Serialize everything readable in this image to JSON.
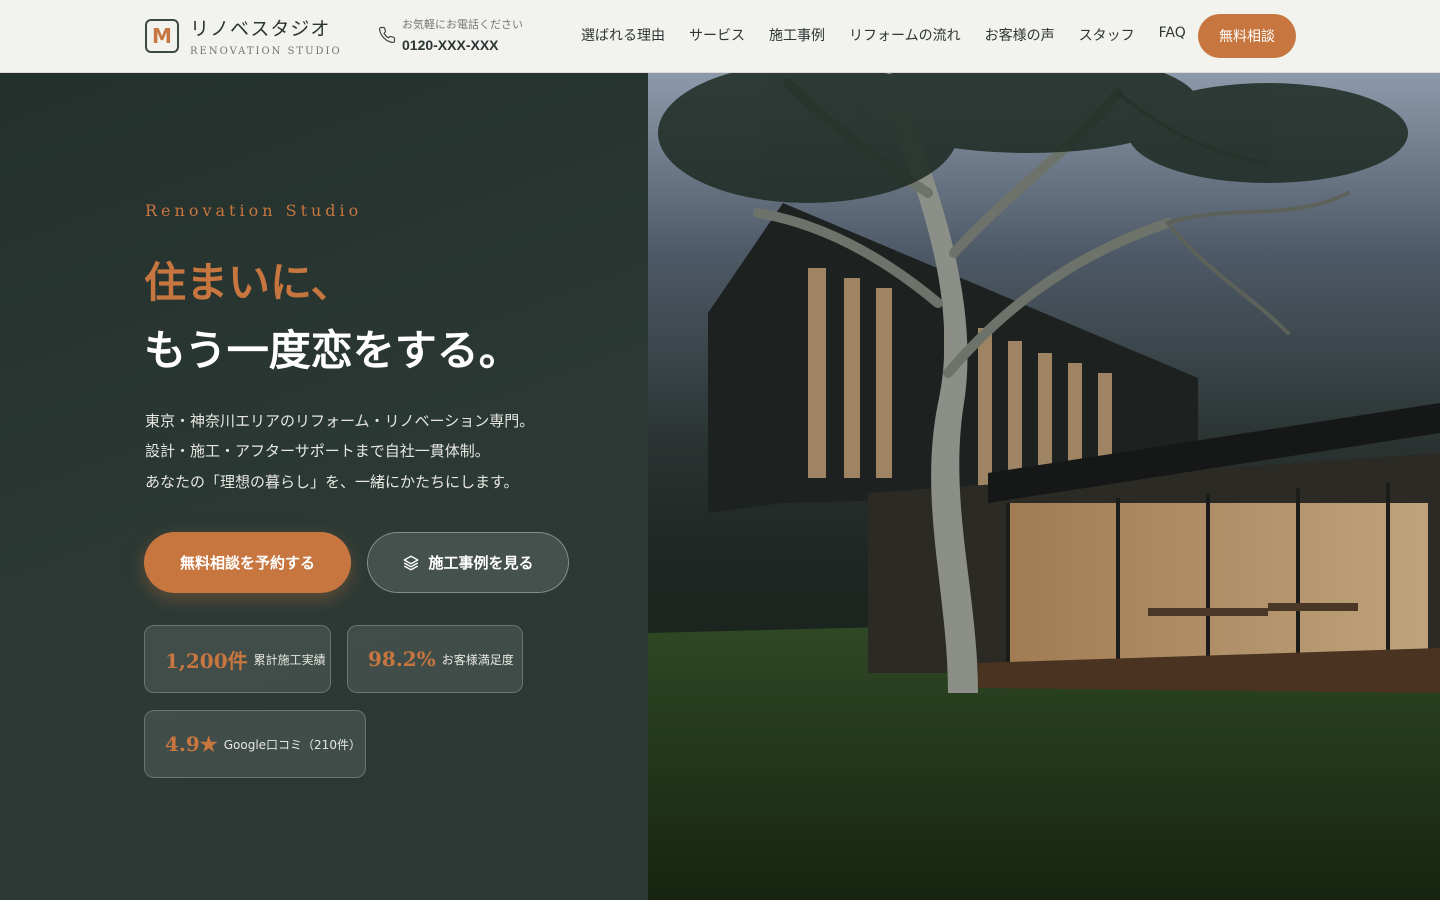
{
  "header": {
    "logo_mark": "M",
    "logo_title": "リノベスタジオ",
    "logo_subtitle": "RENOVATION STUDIO",
    "phone_caption": "お気軽にお電話ください",
    "phone_number": "0120-XXX-XXX",
    "nav": [
      "選ばれる理由",
      "サービス",
      "施工事例",
      "リフォームの流れ",
      "お客様の声",
      "スタッフ",
      "FAQ"
    ],
    "cta_label": "無料相談"
  },
  "hero": {
    "eyebrow": "Renovation Studio",
    "headline_line1": "住まいに、",
    "headline_line2": "もう一度恋をする。",
    "description": [
      "東京・神奈川エリアのリフォーム・リノベーション専門。",
      "設計・施工・アフターサポートまで自社一貫体制。",
      "あなたの「理想の暮らし」を、一緒にかたちにします。"
    ],
    "primary_button": "無料相談を予約する",
    "secondary_button": "施工事例を見る",
    "stats": [
      {
        "value": "1,200件",
        "label": "累計施工実績"
      },
      {
        "value": "98.2%",
        "label": "お客様満足度"
      },
      {
        "value": "4.9★",
        "label": "Google口コミ（210件）"
      }
    ]
  },
  "colors": {
    "accent": "#c8763f",
    "dark_bg": "#23302c",
    "header_bg": "#f2f2ef"
  }
}
